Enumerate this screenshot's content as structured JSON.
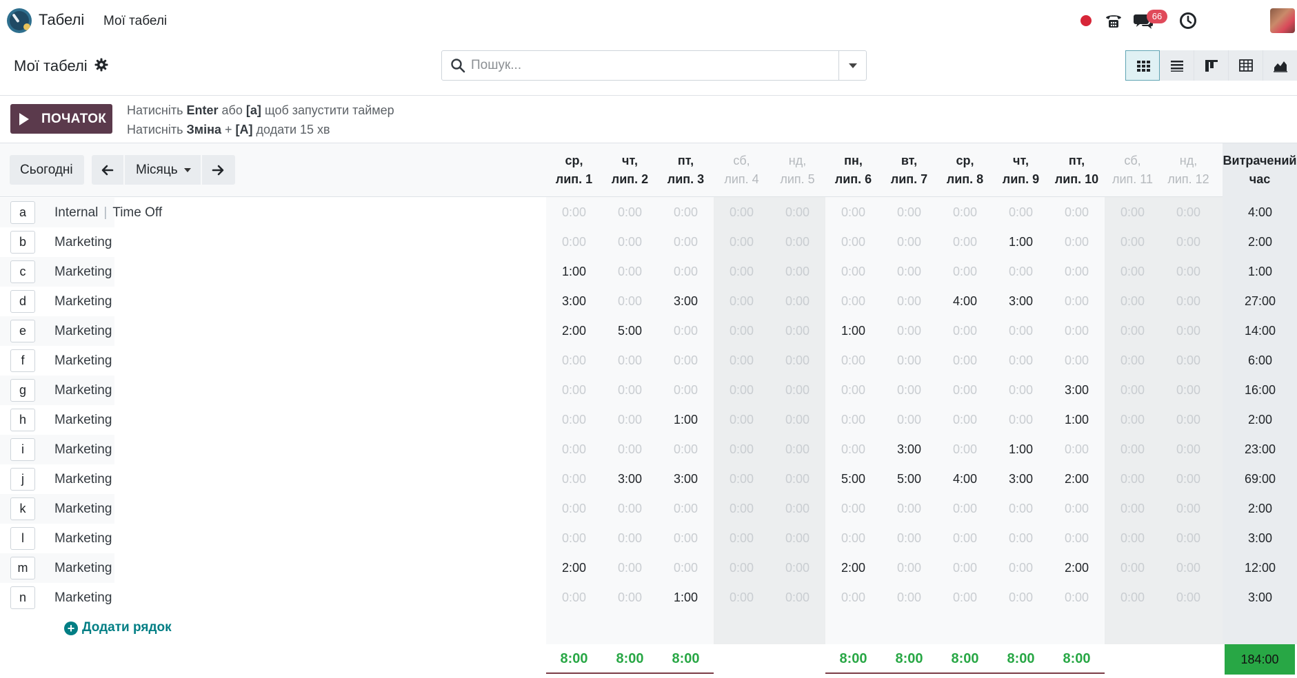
{
  "app": {
    "name": "Табелі",
    "menu": [
      "Мої табелі"
    ]
  },
  "systray": {
    "chat_badge": "66"
  },
  "control_panel": {
    "title": "Мої табелі",
    "search_placeholder": "Пошук...",
    "views": [
      "grid-view-icon",
      "list-view-icon",
      "kanban-view-icon",
      "pivot-view-icon",
      "graph-view-icon"
    ],
    "active_view": "grid-view-icon"
  },
  "timer": {
    "start_label": "ПОЧАТОК",
    "hint1": {
      "a": "Натисніть ",
      "b": "Enter",
      "c": " або ",
      "d": "[a]",
      "e": " щоб запустити таймер"
    },
    "hint2": {
      "a": "Натисніть ",
      "b": "Зміна",
      "c": " + ",
      "d": "[A]",
      "e": " додати 15 хв"
    }
  },
  "nav": {
    "today": "Сьогодні",
    "range": "Місяць"
  },
  "columns": [
    {
      "d": "ср,",
      "m": "лип. 1",
      "weekend": false
    },
    {
      "d": "чт,",
      "m": "лип. 2",
      "weekend": false
    },
    {
      "d": "пт,",
      "m": "лип. 3",
      "weekend": false
    },
    {
      "d": "сб,",
      "m": "лип. 4",
      "weekend": true
    },
    {
      "d": "нд,",
      "m": "лип. 5",
      "weekend": true
    },
    {
      "d": "пн,",
      "m": "лип. 6",
      "weekend": false
    },
    {
      "d": "вт,",
      "m": "лип. 7",
      "weekend": false
    },
    {
      "d": "ср,",
      "m": "лип. 8",
      "weekend": false
    },
    {
      "d": "чт,",
      "m": "лип. 9",
      "weekend": false
    },
    {
      "d": "пт,",
      "m": "лип. 10",
      "weekend": false
    },
    {
      "d": "сб,",
      "m": "лип. 11",
      "weekend": true
    },
    {
      "d": "нд,",
      "m": "лип. 12",
      "weekend": true
    }
  ],
  "total_header": [
    "Витрачений",
    "час"
  ],
  "rows": [
    {
      "key": "a",
      "project": "Internal",
      "task": "Time Off",
      "cells": [
        "0:00",
        "0:00",
        "0:00",
        "0:00",
        "0:00",
        "0:00",
        "0:00",
        "0:00",
        "0:00",
        "0:00",
        "0:00",
        "0:00"
      ],
      "total": "4:00"
    },
    {
      "key": "b",
      "project": "Marketing",
      "task": "",
      "cells": [
        "0:00",
        "0:00",
        "0:00",
        "0:00",
        "0:00",
        "0:00",
        "0:00",
        "0:00",
        "1:00",
        "0:00",
        "0:00",
        "0:00"
      ],
      "total": "2:00"
    },
    {
      "key": "c",
      "project": "Marketing",
      "task": "",
      "cells": [
        "1:00",
        "0:00",
        "0:00",
        "0:00",
        "0:00",
        "0:00",
        "0:00",
        "0:00",
        "0:00",
        "0:00",
        "0:00",
        "0:00"
      ],
      "total": "1:00"
    },
    {
      "key": "d",
      "project": "Marketing",
      "task": "",
      "cells": [
        "3:00",
        "0:00",
        "3:00",
        "0:00",
        "0:00",
        "0:00",
        "0:00",
        "4:00",
        "3:00",
        "0:00",
        "0:00",
        "0:00"
      ],
      "total": "27:00"
    },
    {
      "key": "e",
      "project": "Marketing",
      "task": "",
      "cells": [
        "2:00",
        "5:00",
        "0:00",
        "0:00",
        "0:00",
        "1:00",
        "0:00",
        "0:00",
        "0:00",
        "0:00",
        "0:00",
        "0:00"
      ],
      "total": "14:00"
    },
    {
      "key": "f",
      "project": "Marketing",
      "task": "",
      "cells": [
        "0:00",
        "0:00",
        "0:00",
        "0:00",
        "0:00",
        "0:00",
        "0:00",
        "0:00",
        "0:00",
        "0:00",
        "0:00",
        "0:00"
      ],
      "total": "6:00"
    },
    {
      "key": "g",
      "project": "Marketing",
      "task": "",
      "cells": [
        "0:00",
        "0:00",
        "0:00",
        "0:00",
        "0:00",
        "0:00",
        "0:00",
        "0:00",
        "0:00",
        "3:00",
        "0:00",
        "0:00"
      ],
      "total": "16:00"
    },
    {
      "key": "h",
      "project": "Marketing",
      "task": "",
      "cells": [
        "0:00",
        "0:00",
        "1:00",
        "0:00",
        "0:00",
        "0:00",
        "0:00",
        "0:00",
        "0:00",
        "1:00",
        "0:00",
        "0:00"
      ],
      "total": "2:00"
    },
    {
      "key": "i",
      "project": "Marketing",
      "task": "",
      "cells": [
        "0:00",
        "0:00",
        "0:00",
        "0:00",
        "0:00",
        "0:00",
        "3:00",
        "0:00",
        "1:00",
        "0:00",
        "0:00",
        "0:00"
      ],
      "total": "23:00"
    },
    {
      "key": "j",
      "project": "Marketing",
      "task": "",
      "cells": [
        "0:00",
        "3:00",
        "3:00",
        "0:00",
        "0:00",
        "5:00",
        "5:00",
        "4:00",
        "3:00",
        "2:00",
        "0:00",
        "0:00"
      ],
      "total": "69:00"
    },
    {
      "key": "k",
      "project": "Marketing",
      "task": "",
      "cells": [
        "0:00",
        "0:00",
        "0:00",
        "0:00",
        "0:00",
        "0:00",
        "0:00",
        "0:00",
        "0:00",
        "0:00",
        "0:00",
        "0:00"
      ],
      "total": "2:00"
    },
    {
      "key": "l",
      "project": "Marketing",
      "task": "",
      "cells": [
        "0:00",
        "0:00",
        "0:00",
        "0:00",
        "0:00",
        "0:00",
        "0:00",
        "0:00",
        "0:00",
        "0:00",
        "0:00",
        "0:00"
      ],
      "total": "3:00"
    },
    {
      "key": "m",
      "project": "Marketing",
      "task": "",
      "cells": [
        "2:00",
        "0:00",
        "0:00",
        "0:00",
        "0:00",
        "2:00",
        "0:00",
        "0:00",
        "0:00",
        "2:00",
        "0:00",
        "0:00"
      ],
      "total": "12:00"
    },
    {
      "key": "n",
      "project": "Marketing",
      "task": "",
      "cells": [
        "0:00",
        "0:00",
        "1:00",
        "0:00",
        "0:00",
        "0:00",
        "0:00",
        "0:00",
        "0:00",
        "0:00",
        "0:00",
        "0:00"
      ],
      "total": "3:00"
    }
  ],
  "add_line": "Додати рядок",
  "footer_totals": [
    "8:00",
    "8:00",
    "8:00",
    "",
    "",
    "8:00",
    "8:00",
    "8:00",
    "8:00",
    "8:00",
    "",
    ""
  ],
  "grand_total": "184:00",
  "colors": {
    "primary": "#5b3a4c",
    "accent": "#017e84",
    "success": "#28a745",
    "danger": "#d72638"
  }
}
